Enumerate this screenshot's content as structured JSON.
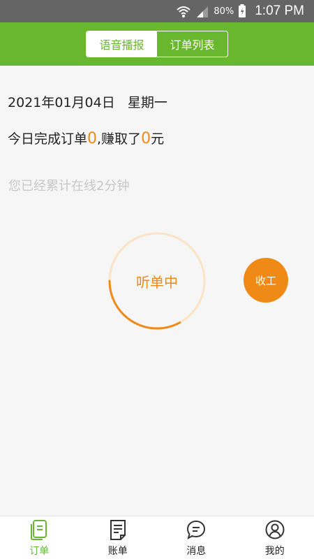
{
  "status_bar": {
    "battery": "80%",
    "time": "1:07 PM"
  },
  "header": {
    "tabs": [
      {
        "label": "语音播报",
        "active": true
      },
      {
        "label": "订单列表",
        "active": false
      }
    ]
  },
  "main": {
    "date": "2021年01月04日",
    "weekday": "星期一",
    "summary": {
      "prefix": "今日完成订单",
      "orders": "0",
      "middle": ",赚取了",
      "earned": "0",
      "suffix": "元"
    },
    "online": "您已经累计在线2分钟",
    "listening": {
      "label": "听单中",
      "progress": 0.33
    },
    "finish_button": "收工"
  },
  "tabbar": {
    "items": [
      {
        "label": "订单",
        "icon": "order-icon",
        "active": true
      },
      {
        "label": "账单",
        "icon": "bill-icon",
        "active": false
      },
      {
        "label": "消息",
        "icon": "message-icon",
        "active": false
      },
      {
        "label": "我的",
        "icon": "profile-icon",
        "active": false
      }
    ]
  },
  "colors": {
    "brand_green": "#69b72e",
    "accent_orange": "#ef8a16"
  }
}
